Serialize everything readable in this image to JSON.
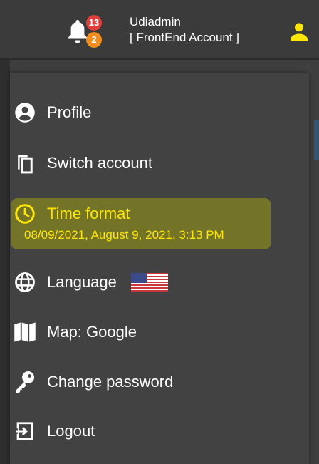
{
  "header": {
    "notifications_count": "13",
    "alerts_count": "2",
    "user_name": "Udiadmin",
    "account_label": "[ FrontEnd Account ]",
    "accent_color": "#ffe600"
  },
  "menu": {
    "profile": {
      "label": "Profile",
      "icon": "account-circle-icon"
    },
    "switch_account": {
      "label": "Switch account",
      "icon": "copy-icon"
    },
    "time_format": {
      "label": "Time format",
      "value": "08/09/2021, August 9, 2021, 3:13 PM",
      "icon": "clock-icon",
      "highlighted": true
    },
    "language": {
      "label": "Language",
      "icon": "globe-icon",
      "flag": "us-flag-icon"
    },
    "map": {
      "label": "Map: Google",
      "icon": "map-icon"
    },
    "change_password": {
      "label": "Change password",
      "icon": "key-icon"
    },
    "logout": {
      "label": "Logout",
      "icon": "logout-icon"
    }
  }
}
